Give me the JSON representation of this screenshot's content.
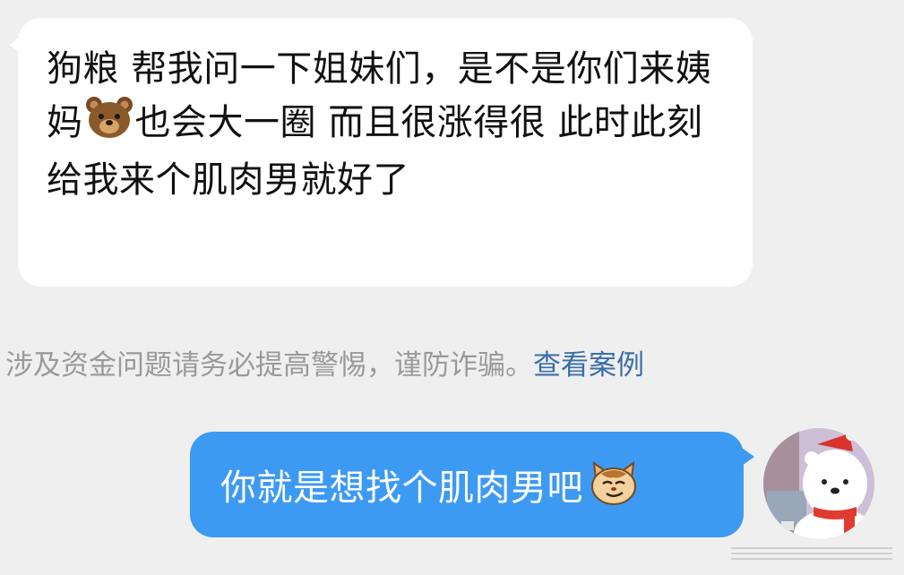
{
  "incoming_message": {
    "text_part1": "狗粮 帮我问一下姐妹们，是不是你们来姨妈",
    "emoji": "bear-face",
    "text_part2": "也会大一圈 而且很涨得很 此时此刻给我来个肌肉男就好了"
  },
  "notice": {
    "text": "涉及资金问题请务必提高警惕，谨防诈骗。",
    "link_label": "查看案例"
  },
  "outgoing_message": {
    "text": "你就是想找个肌肉男吧",
    "emoji": "smirking-cat-face"
  },
  "colors": {
    "background": "#efefef",
    "incoming_bubble": "#ffffff",
    "outgoing_bubble": "#3d9af2",
    "notice_text": "#9a9a9a",
    "notice_link": "#3b6ea8"
  },
  "avatar": {
    "icon": "polar-bear-avatar"
  }
}
